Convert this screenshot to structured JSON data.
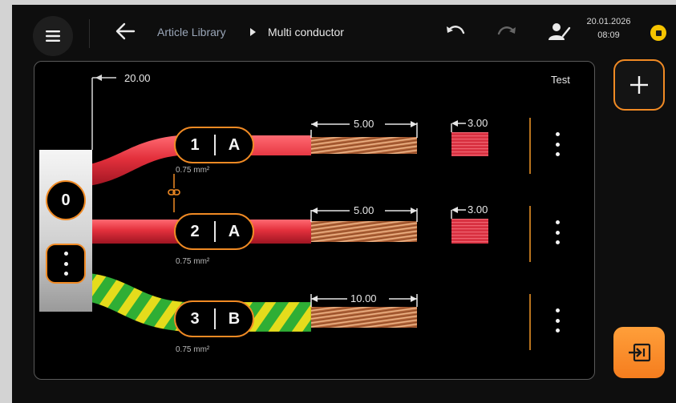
{
  "header": {
    "breadcrumb_library": "Article Library",
    "breadcrumb_current": "Multi conductor",
    "date": "20.01.2026",
    "time": "08:09"
  },
  "canvas": {
    "overall_length": "20.00",
    "corner_label": "Test",
    "bundle_label": "0",
    "conductors": [
      {
        "number": "1",
        "letter": "A",
        "cross_section": "0.75 mm²",
        "strip_length": "5.00",
        "partial_strip": "3.00",
        "color": "red"
      },
      {
        "number": "2",
        "letter": "A",
        "cross_section": "0.75 mm²",
        "strip_length": "5.00",
        "partial_strip": "3.00",
        "color": "red"
      },
      {
        "number": "3",
        "letter": "B",
        "cross_section": "0.75 mm²",
        "strip_length": "10.00",
        "partial_strip": "",
        "color": "green-yellow"
      }
    ]
  },
  "colors": {
    "accent": "#f08a24",
    "wire_red": "#e0303c",
    "wire_green": "#2fae35",
    "wire_yellow": "#e5dc1c",
    "copper": "#c77a4a"
  },
  "icons": {
    "menu": "hamburger-menu-icon",
    "back": "arrow-left-icon",
    "undo": "undo-icon",
    "redo": "redo-icon",
    "user": "user-edit-icon",
    "status": "pause-status-icon",
    "add": "plus-icon",
    "execute": "execute-arrow-icon",
    "link": "link-chain-icon",
    "more": "more-vertical-icon"
  }
}
